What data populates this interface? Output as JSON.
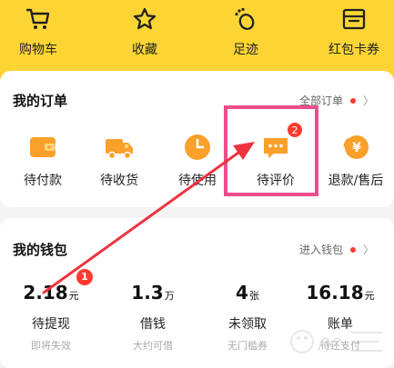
{
  "top_nav": {
    "items": [
      {
        "label": "购物车",
        "icon": "cart-icon"
      },
      {
        "label": "收藏",
        "icon": "star-icon"
      },
      {
        "label": "足迹",
        "icon": "footprint-icon"
      },
      {
        "label": "红包卡券",
        "icon": "coupon-icon"
      }
    ]
  },
  "orders": {
    "title": "我的订单",
    "link": "全部订单",
    "items": [
      {
        "label": "待付款",
        "icon": "wallet-icon"
      },
      {
        "label": "待收货",
        "icon": "truck-icon"
      },
      {
        "label": "待使用",
        "icon": "clock-icon"
      },
      {
        "label": "待评价",
        "icon": "comment-icon",
        "badge": "2"
      },
      {
        "label": "退款/售后",
        "icon": "refund-icon"
      }
    ]
  },
  "wallet": {
    "title": "我的钱包",
    "link": "进入钱包",
    "items": [
      {
        "value": "2.18",
        "unit": "元",
        "label": "待提现",
        "sub": "即将失效",
        "badge": "1"
      },
      {
        "value": "1.3",
        "unit": "万",
        "label": "借钱",
        "sub": "大约可借"
      },
      {
        "value": "4",
        "unit": "张",
        "label": "未领取",
        "sub": "无门槛券"
      },
      {
        "value": "16.18",
        "unit": "元",
        "label": "账单",
        "sub": "待还支付"
      }
    ]
  },
  "colors": {
    "header_yellow": "#fcd535",
    "icon_orange": "#fba02a",
    "badge_red": "#ff3b30",
    "annotation_pink": "#ee4d8c",
    "annotation_arrow": "#ef3340"
  }
}
